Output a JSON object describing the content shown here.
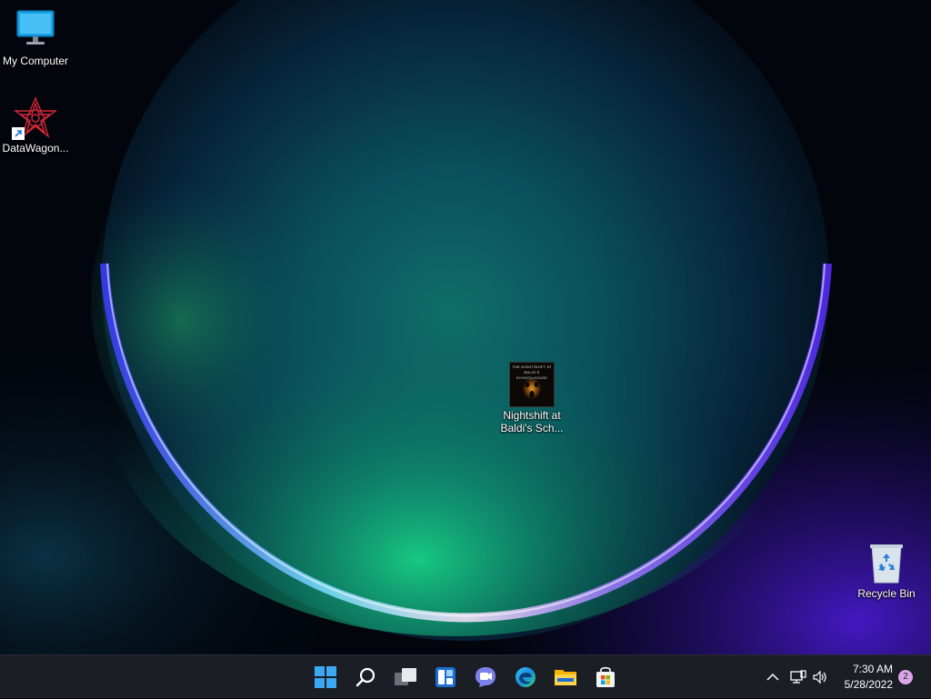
{
  "desktop": {
    "icons": [
      {
        "label": "My Computer"
      },
      {
        "label": "DataWagon..."
      },
      {
        "label": "Nightshift at\nBaldi's Sch...",
        "poster_text": "THE NIGHTSHIFT AT\nBALDI'S SCHOOLHOUSE"
      },
      {
        "label": "Recycle Bin"
      }
    ]
  },
  "taskbar": {
    "apps": [
      "start-icon",
      "search-icon",
      "task-view-icon",
      "widgets-icon",
      "chat-icon",
      "edge-icon",
      "file-explorer-icon",
      "store-icon"
    ],
    "clock": {
      "time": "7:30 AM",
      "date": "5/28/2022"
    },
    "notifications": "2"
  }
}
